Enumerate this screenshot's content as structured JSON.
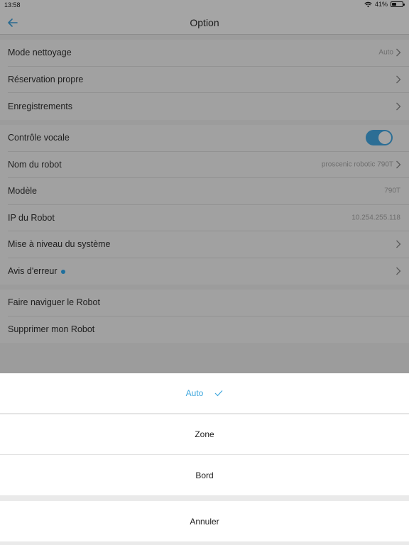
{
  "status_bar": {
    "time": "13:58",
    "battery": "41%",
    "battery_level": 0.41
  },
  "nav": {
    "title": "Option"
  },
  "group1": [
    {
      "label": "Mode nettoyage",
      "value": "Auto"
    },
    {
      "label": "Réservation propre"
    },
    {
      "label": "Enregistrements"
    }
  ],
  "group2": [
    {
      "label": "Contrôle vocale",
      "toggle_on": true
    },
    {
      "label": "Nom du robot",
      "value": "proscenic robotic 790T"
    },
    {
      "label": "Modèle",
      "value": "790T"
    },
    {
      "label": "IP du Robot",
      "value": "10.254.255.118"
    },
    {
      "label": "Mise à niveau du système"
    },
    {
      "label": "Avis d'erreur"
    }
  ],
  "group3": [
    {
      "label": "Faire naviguer le Robot"
    },
    {
      "label": "Supprimer mon Robot"
    }
  ],
  "sheet": {
    "options": [
      {
        "label": "Auto",
        "selected": true
      },
      {
        "label": "Zone",
        "selected": false
      },
      {
        "label": "Bord",
        "selected": false
      }
    ],
    "cancel": "Annuler"
  },
  "colors": {
    "accent": "#3fa7dd",
    "toggle_on": "#2c6e95",
    "dim_bg": "#9c9c9c"
  }
}
